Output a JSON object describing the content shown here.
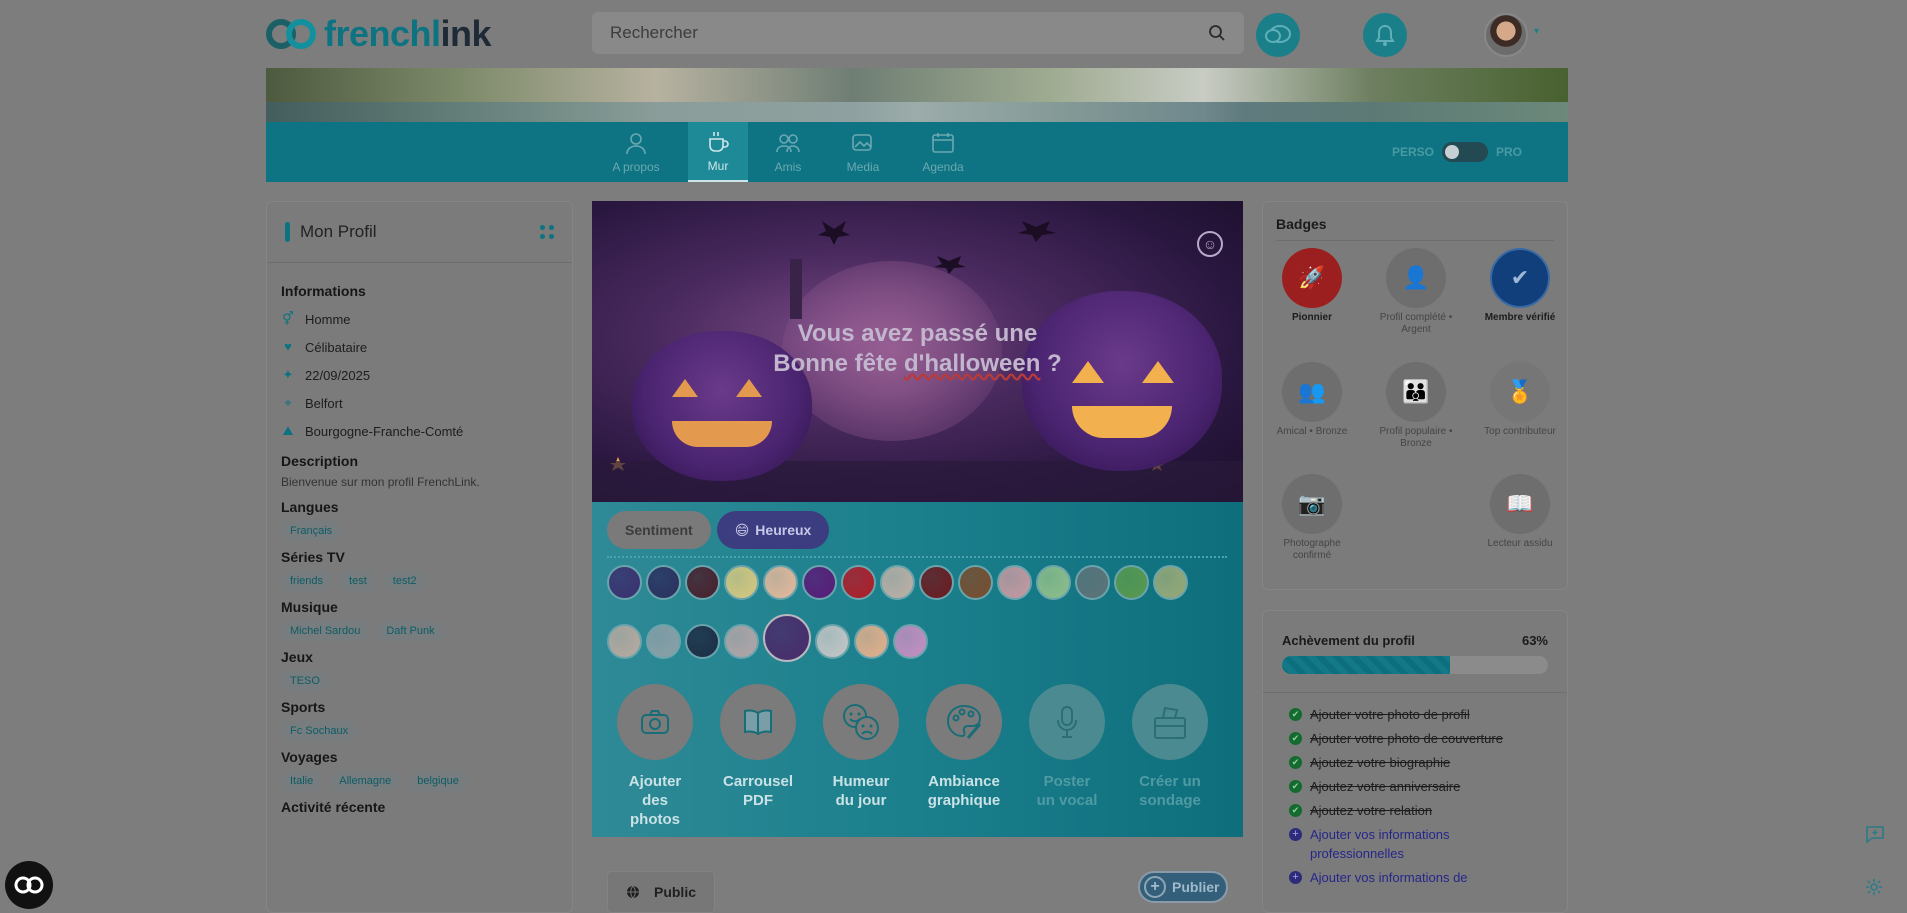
{
  "app": {
    "logo_text_a": "frenchl",
    "logo_text_b": "ink"
  },
  "search": {
    "placeholder": "Rechercher"
  },
  "nav": {
    "items": [
      {
        "label": "A propos",
        "icon": "user-icon"
      },
      {
        "label": "Mur",
        "icon": "coffee-icon",
        "active": true
      },
      {
        "label": "Amis",
        "icon": "friends-icon"
      },
      {
        "label": "Media",
        "icon": "media-icon"
      },
      {
        "label": "Agenda",
        "icon": "calendar-icon"
      }
    ],
    "toggle_left": "PERSO",
    "toggle_right": "PRO"
  },
  "profile": {
    "title": "Mon Profil",
    "info_heading": "Informations",
    "info": [
      {
        "icon": "gender-icon",
        "text": "Homme"
      },
      {
        "icon": "heart-icon",
        "text": "Célibataire"
      },
      {
        "icon": "birthday-icon",
        "text": "22/09/2025"
      },
      {
        "icon": "location-pin-icon",
        "text": "Belfort"
      },
      {
        "icon": "region-icon",
        "text": "Bourgogne-Franche-Comté"
      }
    ],
    "description_heading": "Description",
    "description": "Bienvenue sur mon profil FrenchLink.",
    "sections": [
      {
        "title": "Langues",
        "chips": [
          "Français"
        ]
      },
      {
        "title": "Séries TV",
        "chips": [
          "friends",
          "test",
          "test2"
        ]
      },
      {
        "title": "Musique",
        "chips": [
          "Michel Sardou",
          "Daft Punk"
        ]
      },
      {
        "title": "Jeux",
        "chips": [
          "TESO"
        ]
      },
      {
        "title": "Sports",
        "chips": [
          "Fc Sochaux"
        ]
      },
      {
        "title": "Voyages",
        "chips": [
          "Italie",
          "Allemagne",
          "belgique"
        ]
      }
    ],
    "recent_heading": "Activité récente"
  },
  "composer": {
    "text_line1": "Vous avez passé une",
    "text_line2_a": "Bonne fête ",
    "text_line2_b": "d'halloween",
    "text_line2_c": " ?",
    "tab_sentiment": "Sentiment",
    "tab_mood": "Heureux",
    "swatches_row1": [
      "#3b2f6e",
      "#2b2f5e",
      "#4a1f2c",
      "#d8c980",
      "#e6b99b",
      "#5a1a78",
      "#b11c28",
      "#bfb1a6",
      "#6c1a1f",
      "#7a4d2e",
      "#c79aa2",
      "#8fbf8a",
      "#5e7378",
      "#5a9a4e",
      "#9aaa78"
    ],
    "swatches_row2": [
      "#b9aaa0",
      "#8da0a8",
      "#1e2c44",
      "#b4a6a8",
      "#4a2a6a",
      "#c7c7c7",
      "#e5b08c",
      "#c78fc2"
    ],
    "actions": [
      {
        "line1": "Ajouter",
        "line2": "des photos",
        "icon": "camera-icon",
        "enabled": true
      },
      {
        "line1": "Carrousel",
        "line2": "PDF",
        "icon": "book-icon",
        "enabled": true
      },
      {
        "line1": "Humeur",
        "line2": "du jour",
        "icon": "mood-faces-icon",
        "enabled": true
      },
      {
        "line1": "Ambiance",
        "line2": "graphique",
        "icon": "palette-icon",
        "enabled": true
      },
      {
        "line1": "Poster",
        "line2": "un vocal",
        "icon": "microphone-icon",
        "enabled": false
      },
      {
        "line1": "Créer un",
        "line2": "sondage",
        "icon": "ballot-box-icon",
        "enabled": false
      }
    ],
    "visibility": "Public",
    "publish": "Publier"
  },
  "badges": {
    "title": "Badges",
    "items": [
      {
        "name": "Pionnier",
        "earned": true,
        "color": "#9c1f1f",
        "icon": "rocket-icon"
      },
      {
        "name": "Profil complété • Argent",
        "earned": false,
        "icon": "user-check-icon"
      },
      {
        "name": "Membre vérifié",
        "earned": true,
        "color": "#103f7c",
        "icon": "verified-icon"
      },
      {
        "name": "Amical • Bronze",
        "earned": false,
        "icon": "users-icon"
      },
      {
        "name": "Profil populaire • Bronze",
        "earned": false,
        "icon": "group-icon"
      },
      {
        "name": "Top contributeur",
        "earned": false,
        "icon": "medal-icon"
      },
      {
        "name": "Photographe confirmé",
        "earned": false,
        "icon": "camera-badge-icon"
      },
      {
        "name": "Lecteur assidu",
        "earned": false,
        "icon": "open-book-icon"
      }
    ]
  },
  "completion": {
    "title": "Achèvement du profil",
    "percent_label": "63%",
    "percent": 0.63,
    "tasks": [
      {
        "text": "Ajouter votre photo de profil",
        "done": true
      },
      {
        "text": "Ajouter votre photo de couverture",
        "done": true
      },
      {
        "text": "Ajoutez votre biographie",
        "done": true
      },
      {
        "text": "Ajoutez votre anniversaire",
        "done": true
      },
      {
        "text": "Ajoutez votre relation",
        "done": true
      },
      {
        "text": "Ajouter vos informations professionnelles",
        "done": false
      },
      {
        "text": "Ajouter vos informations de",
        "done": false
      }
    ]
  }
}
